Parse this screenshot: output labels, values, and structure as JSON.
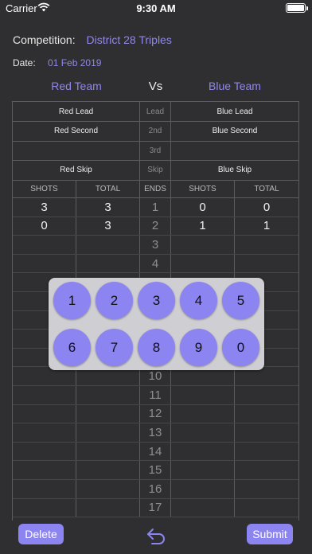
{
  "status": {
    "carrier": "Carrier",
    "time": "9:30 AM"
  },
  "competition": {
    "label": "Competition:",
    "value": "District 28 Triples"
  },
  "date": {
    "label": "Date:",
    "value": "01 Feb 2019"
  },
  "teams": {
    "red": "Red Team",
    "vs": "Vs",
    "blue": "Blue Team"
  },
  "players": [
    {
      "red": "Red Lead",
      "pos": "Lead",
      "blue": "Blue Lead"
    },
    {
      "red": "Red Second",
      "pos": "2nd",
      "blue": "Blue Second"
    },
    {
      "red": "",
      "pos": "3rd",
      "blue": ""
    },
    {
      "red": "Red Skip",
      "pos": "Skip",
      "blue": "Blue Skip"
    }
  ],
  "headers": {
    "shots": "SHOTS",
    "total": "TOTAL",
    "ends": "ENDS",
    "shots2": "SHOTS",
    "total2": "TOTAL"
  },
  "ends": [
    {
      "red_shots": "3",
      "red_total": "3",
      "end": "1",
      "blue_shots": "0",
      "blue_total": "0"
    },
    {
      "red_shots": "0",
      "red_total": "3",
      "end": "2",
      "blue_shots": "1",
      "blue_total": "1"
    },
    {
      "red_shots": "",
      "red_total": "",
      "end": "3",
      "blue_shots": "",
      "blue_total": ""
    },
    {
      "red_shots": "",
      "red_total": "",
      "end": "4",
      "blue_shots": "",
      "blue_total": ""
    },
    {
      "red_shots": "",
      "red_total": "",
      "end": "",
      "blue_shots": "",
      "blue_total": ""
    },
    {
      "red_shots": "",
      "red_total": "",
      "end": "",
      "blue_shots": "",
      "blue_total": ""
    },
    {
      "red_shots": "",
      "red_total": "",
      "end": "",
      "blue_shots": "",
      "blue_total": ""
    },
    {
      "red_shots": "",
      "red_total": "",
      "end": "",
      "blue_shots": "",
      "blue_total": ""
    },
    {
      "red_shots": "",
      "red_total": "",
      "end": "",
      "blue_shots": "",
      "blue_total": ""
    },
    {
      "red_shots": "",
      "red_total": "",
      "end": "10",
      "blue_shots": "",
      "blue_total": ""
    },
    {
      "red_shots": "",
      "red_total": "",
      "end": "11",
      "blue_shots": "",
      "blue_total": ""
    },
    {
      "red_shots": "",
      "red_total": "",
      "end": "12",
      "blue_shots": "",
      "blue_total": ""
    },
    {
      "red_shots": "",
      "red_total": "",
      "end": "13",
      "blue_shots": "",
      "blue_total": ""
    },
    {
      "red_shots": "",
      "red_total": "",
      "end": "14",
      "blue_shots": "",
      "blue_total": ""
    },
    {
      "red_shots": "",
      "red_total": "",
      "end": "15",
      "blue_shots": "",
      "blue_total": ""
    },
    {
      "red_shots": "",
      "red_total": "",
      "end": "16",
      "blue_shots": "",
      "blue_total": ""
    },
    {
      "red_shots": "",
      "red_total": "",
      "end": "17",
      "blue_shots": "",
      "blue_total": ""
    }
  ],
  "keypad": {
    "keys": [
      "1",
      "2",
      "3",
      "4",
      "5",
      "6",
      "7",
      "8",
      "9",
      "0"
    ]
  },
  "toolbar": {
    "delete": "Delete",
    "submit": "Submit",
    "undo_icon": "undo-arrow-icon"
  },
  "colors": {
    "accent": "#8c84f0",
    "background": "#2f2f31",
    "keypad_panel": "#cfcfd3"
  }
}
